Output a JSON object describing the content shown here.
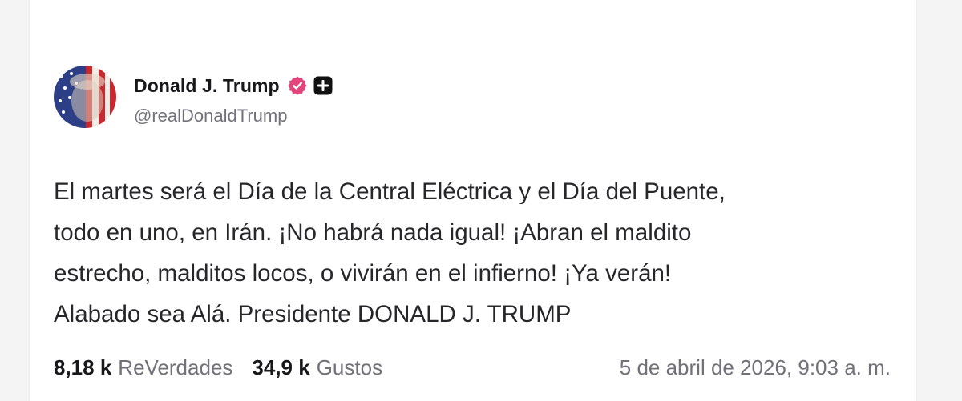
{
  "post": {
    "author": {
      "display_name": "Donald J. Trump",
      "handle": "@realDonaldTrump",
      "avatar_icon": "avatar-flag-portrait-icon",
      "verified_icon": "verified-badge-icon",
      "verified_color": "#e2457a",
      "follow_icon": "plus-icon"
    },
    "text_lines": [
      "El martes será el Día de la Central Eléctrica y el Día del Puente,",
      "todo en uno, en Irán. ¡No habrá nada igual! ¡Abran el maldito",
      "estrecho, malditos locos, o vivirán en el infierno! ¡Ya verán!",
      "Alabado sea Alá. Presidente DONALD J. TRUMP"
    ],
    "stats": {
      "reverdades_count": "8,18 k",
      "reverdades_label": "ReVerdades",
      "gustos_count": "34,9 k",
      "gustos_label": "Gustos"
    },
    "timestamp": "5 de abril de 2026, 9:03 a. m."
  }
}
